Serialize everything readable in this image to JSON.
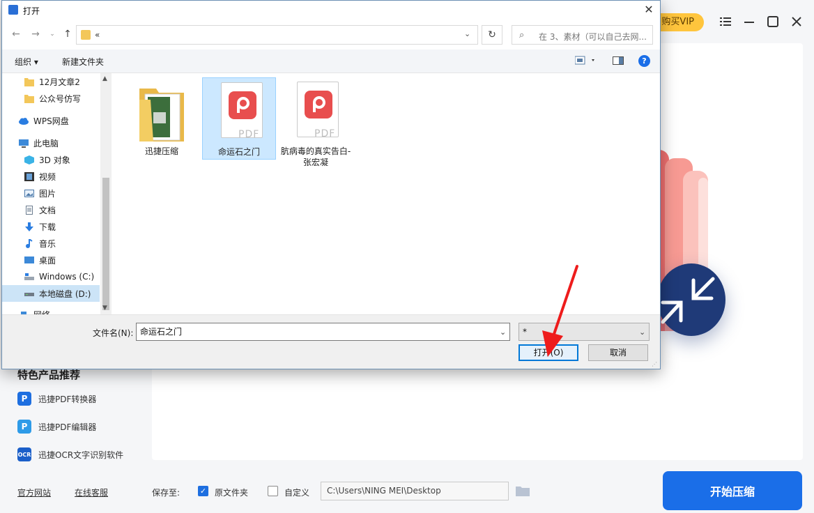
{
  "app": {
    "vip_label": "购买VIP",
    "recommend_title": "特色产品推荐",
    "recommend_items": [
      {
        "label": "迅捷PDF转换器",
        "icon": "pdf-converter-icon"
      },
      {
        "label": "迅捷PDF编辑器",
        "icon": "pdf-editor-icon"
      },
      {
        "label": "迅捷OCR文字识别软件",
        "icon": "ocr-icon"
      }
    ],
    "footer": {
      "official_site": "官方网站",
      "online_service": "在线客服",
      "save_to": "保存至:",
      "original_folder": "原文件夹",
      "custom": "自定义",
      "path": "C:\\Users\\NING MEI\\Desktop",
      "start_button": "开始压缩"
    },
    "colors": {
      "accent": "#1a6ee8",
      "vip": "#ffc53d",
      "badge": "#1f3a78"
    }
  },
  "dialog": {
    "title": "打开",
    "address": "«",
    "search_placeholder": "在 3、素材（可以自己去网...",
    "toolbar": {
      "organize": "组织 ▾",
      "new_folder": "新建文件夹"
    },
    "nav_items": [
      {
        "label": "12月文章2",
        "icon": "folder-icon"
      },
      {
        "label": "公众号仿写",
        "icon": "folder-icon"
      },
      {
        "label": "WPS网盘",
        "icon": "cloud-icon"
      },
      {
        "label": "此电脑",
        "icon": "computer-icon"
      },
      {
        "label": "3D 对象",
        "icon": "3d-objects-icon"
      },
      {
        "label": "视频",
        "icon": "video-icon"
      },
      {
        "label": "图片",
        "icon": "pictures-icon"
      },
      {
        "label": "文档",
        "icon": "documents-icon"
      },
      {
        "label": "下载",
        "icon": "download-icon"
      },
      {
        "label": "音乐",
        "icon": "music-icon"
      },
      {
        "label": "桌面",
        "icon": "desktop-icon"
      },
      {
        "label": "Windows (C:)",
        "icon": "drive-icon"
      },
      {
        "label": "本地磁盘 (D:)",
        "icon": "drive-icon"
      },
      {
        "label": "网络",
        "icon": "network-icon"
      }
    ],
    "files": [
      {
        "name": "迅捷压缩",
        "type": "folder"
      },
      {
        "name": "命运石之门",
        "type": "pdf"
      },
      {
        "name": "肮病毒的真实告白-张宏凝",
        "type": "pdf"
      }
    ],
    "file_name_label": "文件名(N):",
    "file_name_value": "命运石之门",
    "file_type_value": "*",
    "open_button": "打开(O)",
    "cancel_button": "取消"
  }
}
